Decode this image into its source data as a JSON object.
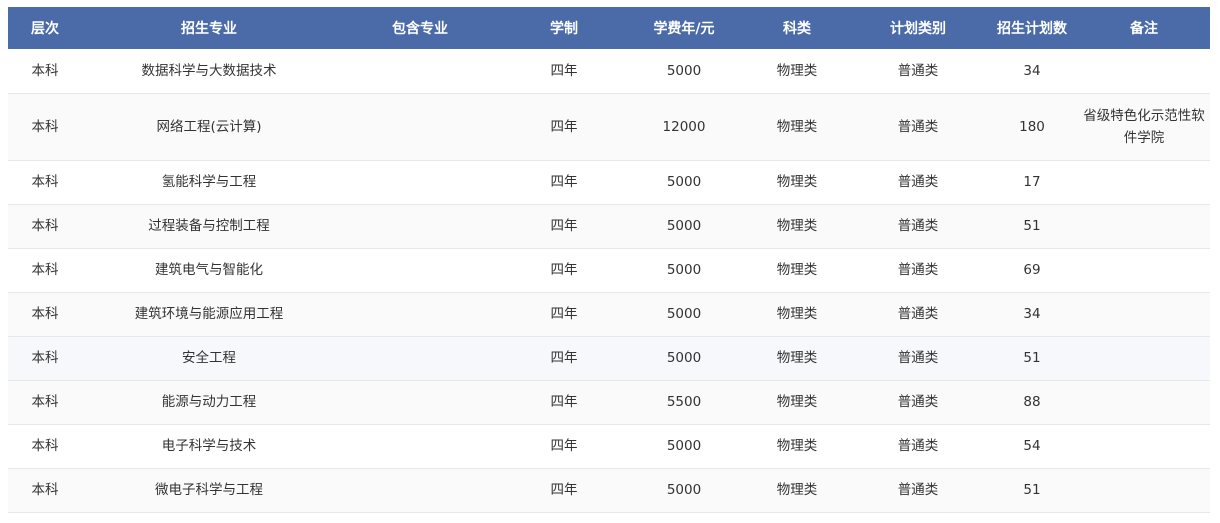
{
  "headers": [
    "层次",
    "招生专业",
    "包含专业",
    "学制",
    "学费年/元",
    "科类",
    "计划类别",
    "招生计划数",
    "备注"
  ],
  "rows": [
    {
      "level": "本科",
      "major": "数据科学与大数据技术",
      "included": "",
      "duration": "四年",
      "fee": "5000",
      "category": "物理类",
      "plan_type": "普通类",
      "plan_count": "34",
      "note": ""
    },
    {
      "level": "本科",
      "major": "网络工程(云计算)",
      "included": "",
      "duration": "四年",
      "fee": "12000",
      "category": "物理类",
      "plan_type": "普通类",
      "plan_count": "180",
      "note": "省级特色化示范性软件学院"
    },
    {
      "level": "本科",
      "major": "氢能科学与工程",
      "included": "",
      "duration": "四年",
      "fee": "5000",
      "category": "物理类",
      "plan_type": "普通类",
      "plan_count": "17",
      "note": ""
    },
    {
      "level": "本科",
      "major": "过程装备与控制工程",
      "included": "",
      "duration": "四年",
      "fee": "5000",
      "category": "物理类",
      "plan_type": "普通类",
      "plan_count": "51",
      "note": ""
    },
    {
      "level": "本科",
      "major": "建筑电气与智能化",
      "included": "",
      "duration": "四年",
      "fee": "5000",
      "category": "物理类",
      "plan_type": "普通类",
      "plan_count": "69",
      "note": ""
    },
    {
      "level": "本科",
      "major": "建筑环境与能源应用工程",
      "included": "",
      "duration": "四年",
      "fee": "5000",
      "category": "物理类",
      "plan_type": "普通类",
      "plan_count": "34",
      "note": ""
    },
    {
      "level": "本科",
      "major": "安全工程",
      "included": "",
      "duration": "四年",
      "fee": "5000",
      "category": "物理类",
      "plan_type": "普通类",
      "plan_count": "51",
      "note": ""
    },
    {
      "level": "本科",
      "major": "能源与动力工程",
      "included": "",
      "duration": "四年",
      "fee": "5500",
      "category": "物理类",
      "plan_type": "普通类",
      "plan_count": "88",
      "note": ""
    },
    {
      "level": "本科",
      "major": "电子科学与技术",
      "included": "",
      "duration": "四年",
      "fee": "5000",
      "category": "物理类",
      "plan_type": "普通类",
      "plan_count": "54",
      "note": ""
    },
    {
      "level": "本科",
      "major": "微电子科学与工程",
      "included": "",
      "duration": "四年",
      "fee": "5000",
      "category": "物理类",
      "plan_type": "普通类",
      "plan_count": "51",
      "note": ""
    }
  ],
  "colors": {
    "header_bg": "#4a6aa8",
    "header_text": "#ffffff",
    "body_text": "#333333",
    "row_border": "#e8e8e8"
  }
}
